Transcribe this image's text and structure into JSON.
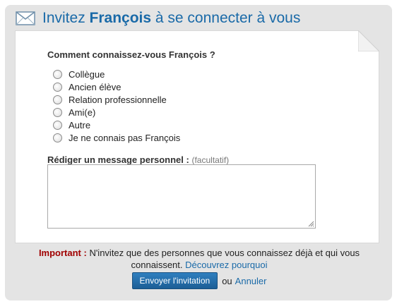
{
  "header": {
    "title_prefix": "Invitez ",
    "title_name": "François",
    "title_suffix": " à se connecter à vous"
  },
  "form": {
    "question": "Comment connaissez-vous François ?",
    "options": [
      {
        "label": "Collègue"
      },
      {
        "label": "Ancien élève"
      },
      {
        "label": "Relation professionnelle"
      },
      {
        "label": "Ami(e)"
      },
      {
        "label": "Autre"
      },
      {
        "label": "Je ne connais pas François"
      }
    ],
    "message_label": "Rédiger un message personnel :",
    "message_optional": "(facultatif)",
    "message_value": ""
  },
  "notice": {
    "important_label": "Important :",
    "text": " N'invitez que des personnes que vous connaissez déjà et qui vous connaissent. ",
    "link": "Découvrez pourquoi"
  },
  "actions": {
    "submit_label": "Envoyer l'invitation",
    "or_text": "ou",
    "cancel_label": "Annuler"
  },
  "colors": {
    "accent": "#1a6aa8",
    "important": "#a00000",
    "panel_bg": "#e4e4e4"
  }
}
